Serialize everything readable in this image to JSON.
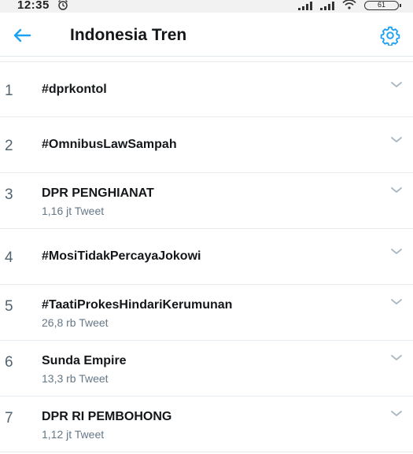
{
  "status_bar": {
    "time": "12:35",
    "battery": "61"
  },
  "header": {
    "title": "Indonesia Tren"
  },
  "accent_color": "#1da1f2",
  "trends": [
    {
      "rank": "1",
      "name": "#dprkontol",
      "meta": ""
    },
    {
      "rank": "2",
      "name": "#OmnibusLawSampah",
      "meta": ""
    },
    {
      "rank": "3",
      "name": "DPR PENGHIANAT",
      "meta": "1,16 jt Tweet"
    },
    {
      "rank": "4",
      "name": "#MosiTidakPercayaJokowi",
      "meta": ""
    },
    {
      "rank": "5",
      "name": "#TaatiProkesHindariKerumunan",
      "meta": "26,8 rb Tweet"
    },
    {
      "rank": "6",
      "name": "Sunda Empire",
      "meta": "13,3 rb Tweet"
    },
    {
      "rank": "7",
      "name": "DPR RI PEMBOHONG",
      "meta": "1,12 jt Tweet"
    }
  ]
}
